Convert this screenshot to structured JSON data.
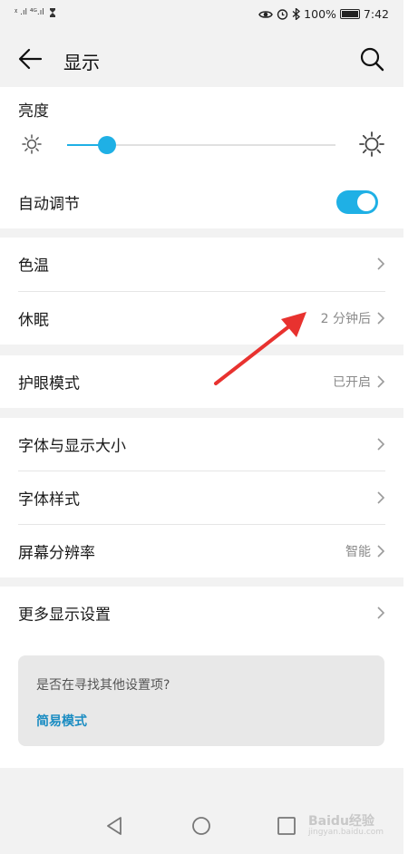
{
  "status_bar": {
    "signal_left": "ᵡ .ıl ⁴ᴳ.ıl",
    "battery_pct": "100%",
    "time": "7:42"
  },
  "header": {
    "title": "显示"
  },
  "brightness": {
    "label": "亮度",
    "level": 0.15,
    "auto_label": "自动调节",
    "auto_on": true
  },
  "groups": [
    {
      "items": [
        {
          "label": "色温",
          "value": ""
        },
        {
          "label": "休眠",
          "value": "2 分钟后"
        }
      ]
    },
    {
      "items": [
        {
          "label": "护眼模式",
          "value": "已开启"
        }
      ]
    },
    {
      "items": [
        {
          "label": "字体与显示大小",
          "value": ""
        },
        {
          "label": "字体样式",
          "value": ""
        },
        {
          "label": "屏幕分辨率",
          "value": "智能"
        }
      ]
    },
    {
      "items": [
        {
          "label": "更多显示设置",
          "value": ""
        }
      ]
    }
  ],
  "hint": {
    "question": "是否在寻找其他设置项?",
    "link": "简易模式"
  },
  "watermark": {
    "brand": "Baidu经验",
    "sub": "jingyan.baidu.com"
  },
  "colors": {
    "accent": "#1fb0e5",
    "annotation_arrow": "#e8322f"
  }
}
